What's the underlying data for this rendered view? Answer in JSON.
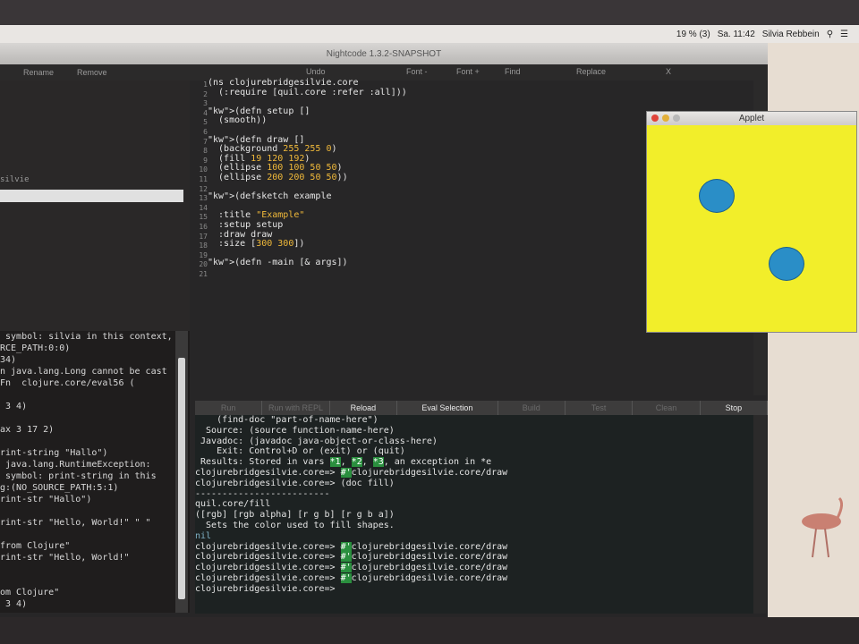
{
  "menubar": {
    "clock": "Sa. 11:42",
    "user": "Silvia Rebbein",
    "battery": "19 % (3)"
  },
  "window": {
    "title": "Nightcode 1.3.2-SNAPSHOT"
  },
  "file_toolbar": {
    "rename": "Rename",
    "remove": "Remove"
  },
  "editor_toolbar": {
    "undo": "Undo",
    "font_minus": "Font -",
    "font_plus": "Font +",
    "find": "Find",
    "replace": "Replace",
    "close": "X"
  },
  "tree": {
    "label": "silvie"
  },
  "editor": {
    "line_numbers": [
      "1",
      "2",
      "3",
      "4",
      "5",
      "6",
      "7",
      "8",
      "9",
      "10",
      "11",
      "12",
      "13",
      "14",
      "15",
      "16",
      "17",
      "18",
      "19",
      "20",
      "21"
    ],
    "lines": [
      "(ns clojurebridgesilvie.core",
      "  (:require [quil.core :refer :all]))",
      "",
      "(defn setup []",
      "  (smooth))",
      "",
      "(defn draw []",
      "  (background 255 255 0)",
      "  (fill 19 120 192)",
      "  (ellipse 100 100 50 50)",
      "  (ellipse 200 200 50 50))",
      "",
      "(defsketch example",
      "",
      "  :title \"Example\"",
      "  :setup setup",
      "  :draw draw",
      "  :size [300 300])",
      "",
      "(defn -main [& args])",
      ""
    ]
  },
  "buttons": {
    "run": "Run",
    "run_repl": "Run with REPL",
    "reload": "Reload",
    "eval_selection": "Eval Selection",
    "build": "Build",
    "test": "Test",
    "clean": "Clean",
    "stop": "Stop"
  },
  "repl": {
    "lines": [
      "    (find-doc \"part-of-name-here\")",
      "  Source: (source function-name-here)",
      " Javadoc: (javadoc java-object-or-class-here)",
      "    Exit: Control+D or (exit) or (quit)",
      " Results: Stored in vars *1, *2, *3, an exception in *e",
      "",
      "clojurebridgesilvie.core=> #'clojurebridgesilvie.core/draw",
      "clojurebridgesilvie.core=> (doc fill)",
      "-------------------------",
      "quil.core/fill",
      "([rgb] [rgb alpha] [r g b] [r g b a])",
      "  Sets the color used to fill shapes.",
      "nil",
      "clojurebridgesilvie.core=> #'clojurebridgesilvie.core/draw",
      "clojurebridgesilvie.core=> #'clojurebridgesilvie.core/draw",
      "clojurebridgesilvie.core=> #'clojurebridgesilvie.core/draw",
      "clojurebridgesilvie.core=> #'clojurebridgesilvie.core/draw",
      "clojurebridgesilvie.core=>"
    ]
  },
  "left_repl": {
    "lines": [
      " symbol: silvia in this context,",
      "RCE_PATH:0:0)",
      "34)",
      "n java.lang.Long cannot be cast",
      "Fn  clojure.core/eval56 (",
      "",
      " 3 4)",
      "",
      "ax 3 17 2)",
      "",
      "rint-string \"Hallo\")",
      " java.lang.RuntimeException:",
      " symbol: print-string in this",
      "g:(NO_SOURCE_PATH:5:1)",
      "rint-str \"Hallo\")",
      "",
      "rint-str \"Hello, World!\" \" \"",
      "",
      "from Clojure\"",
      "rint-str \"Hello, World!\"",
      "",
      "",
      "om Clojure\"",
      " 3 4)"
    ]
  },
  "applet": {
    "title": "Applet"
  },
  "colors": {
    "applet_background": "#f2ee2a",
    "ball_fill": "#2a8ec7",
    "keyword": "#e8c24a",
    "repl_background": "#1d2222"
  }
}
